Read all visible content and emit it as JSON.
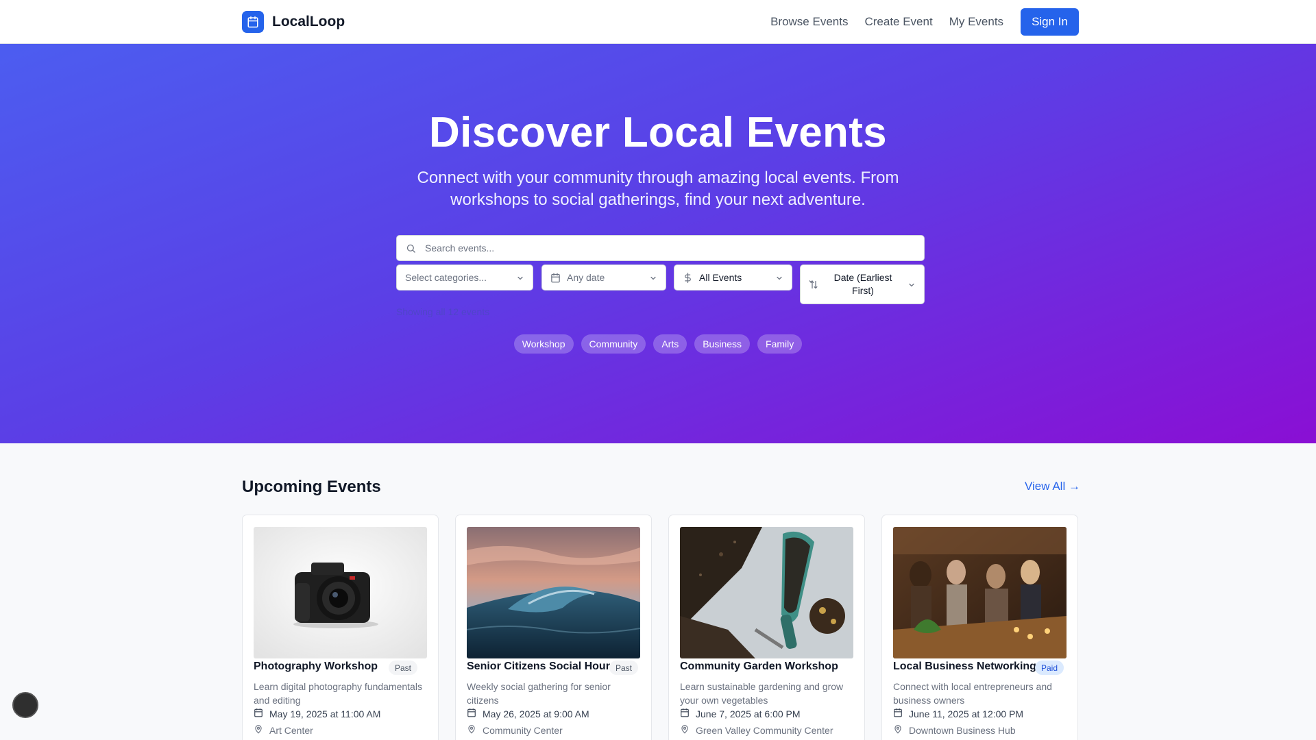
{
  "header": {
    "brand": "LocalLoop",
    "nav": [
      "Browse Events",
      "Create Event",
      "My Events"
    ],
    "sign_in": "Sign In"
  },
  "hero": {
    "title": "Discover Local Events",
    "subtitle": "Connect with your community through amazing local events. From workshops to social gatherings, find your next adventure.",
    "search_placeholder": "Search events...",
    "filters": {
      "categories": "Select categories...",
      "date": "Any date",
      "price": "All Events",
      "sort": "Date (Earliest First)"
    },
    "showing": "Showing all 12 events",
    "tags": [
      "Workshop",
      "Community",
      "Arts",
      "Business",
      "Family"
    ]
  },
  "events_section": {
    "title": "Upcoming Events",
    "view_all": "View All →",
    "cards": [
      {
        "title": "Photography Workshop",
        "badge": "Past",
        "description": "Learn digital photography fundamentals and editing",
        "date": "May 19, 2025 at 11:00 AM",
        "location": "Art Center",
        "image": "camera-photo"
      },
      {
        "title": "Senior Citizens Social Hour",
        "badge": "Past",
        "description": "Weekly social gathering for senior citizens",
        "date": "May 26, 2025 at 9:00 AM",
        "location": "Community Center",
        "image": "ocean-wave-photo"
      },
      {
        "title": "Community Garden Workshop",
        "badge": "",
        "description": "Learn sustainable gardening and grow your own vegetables",
        "date": "June 7, 2025 at 6:00 PM",
        "location": "Green Valley Community Center",
        "image": "garden-trowel-photo"
      },
      {
        "title": "Local Business Networking",
        "badge": "Paid",
        "description": "Connect with local entrepreneurs and business owners",
        "date": "June 11, 2025 at 12:00 PM",
        "location": "Downtown Business Hub",
        "image": "networking-people-photo"
      }
    ]
  },
  "colors": {
    "primary": "#2563eb",
    "hero_gradient_start": "#4c5df0",
    "hero_gradient_end": "#8a0fd4"
  }
}
